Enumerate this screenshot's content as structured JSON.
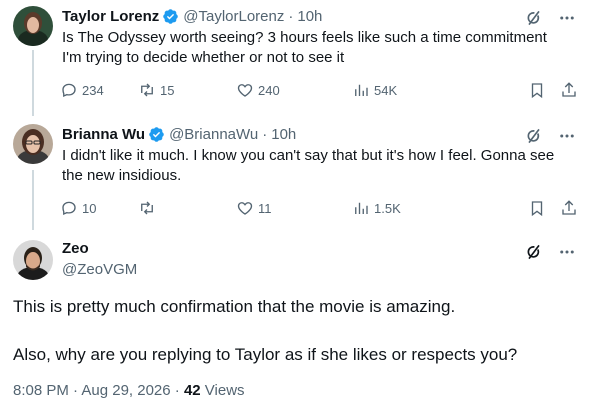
{
  "thread": [
    {
      "name": "Taylor Lorenz",
      "handle": "@TaylorLorenz",
      "separator": "·",
      "time": "10h",
      "text_line1": "Is The Odyssey worth seeing? 3 hours feels like such a time commitment",
      "text_line2": "I'm trying to decide whether or not to see it",
      "replies": "234",
      "retweets": "15",
      "likes": "240",
      "views": "54K"
    },
    {
      "name": "Brianna Wu",
      "handle": "@BriannaWu",
      "separator": "·",
      "time": "10h",
      "text_line1": "I didn't like it much. I know you can't say that but it's how I feel. Gonna see",
      "text_line2": "the new insidious.",
      "replies": "10",
      "retweets": "",
      "likes": "11",
      "views": "1.5K"
    }
  ],
  "main_tweet": {
    "name": "Zeo",
    "handle": "@ZeoVGM",
    "text_para1": "This is pretty much confirmation that the movie is amazing.",
    "text_para2": "Also, why are you replying to Taylor as if she likes or respects you?",
    "timestamp": "8:08 PM · Aug 29, 2026 · ",
    "views_count": "42",
    "views_label": " Views"
  },
  "colors": {
    "verified_blue": "#1d9bf0",
    "secondary_text": "#536471",
    "thread_line": "#cfd9de"
  },
  "icons": [
    "verified-badge-icon",
    "grok-icon",
    "more-icon",
    "reply-icon",
    "retweet-icon",
    "like-icon",
    "views-icon",
    "bookmark-icon",
    "share-icon"
  ]
}
